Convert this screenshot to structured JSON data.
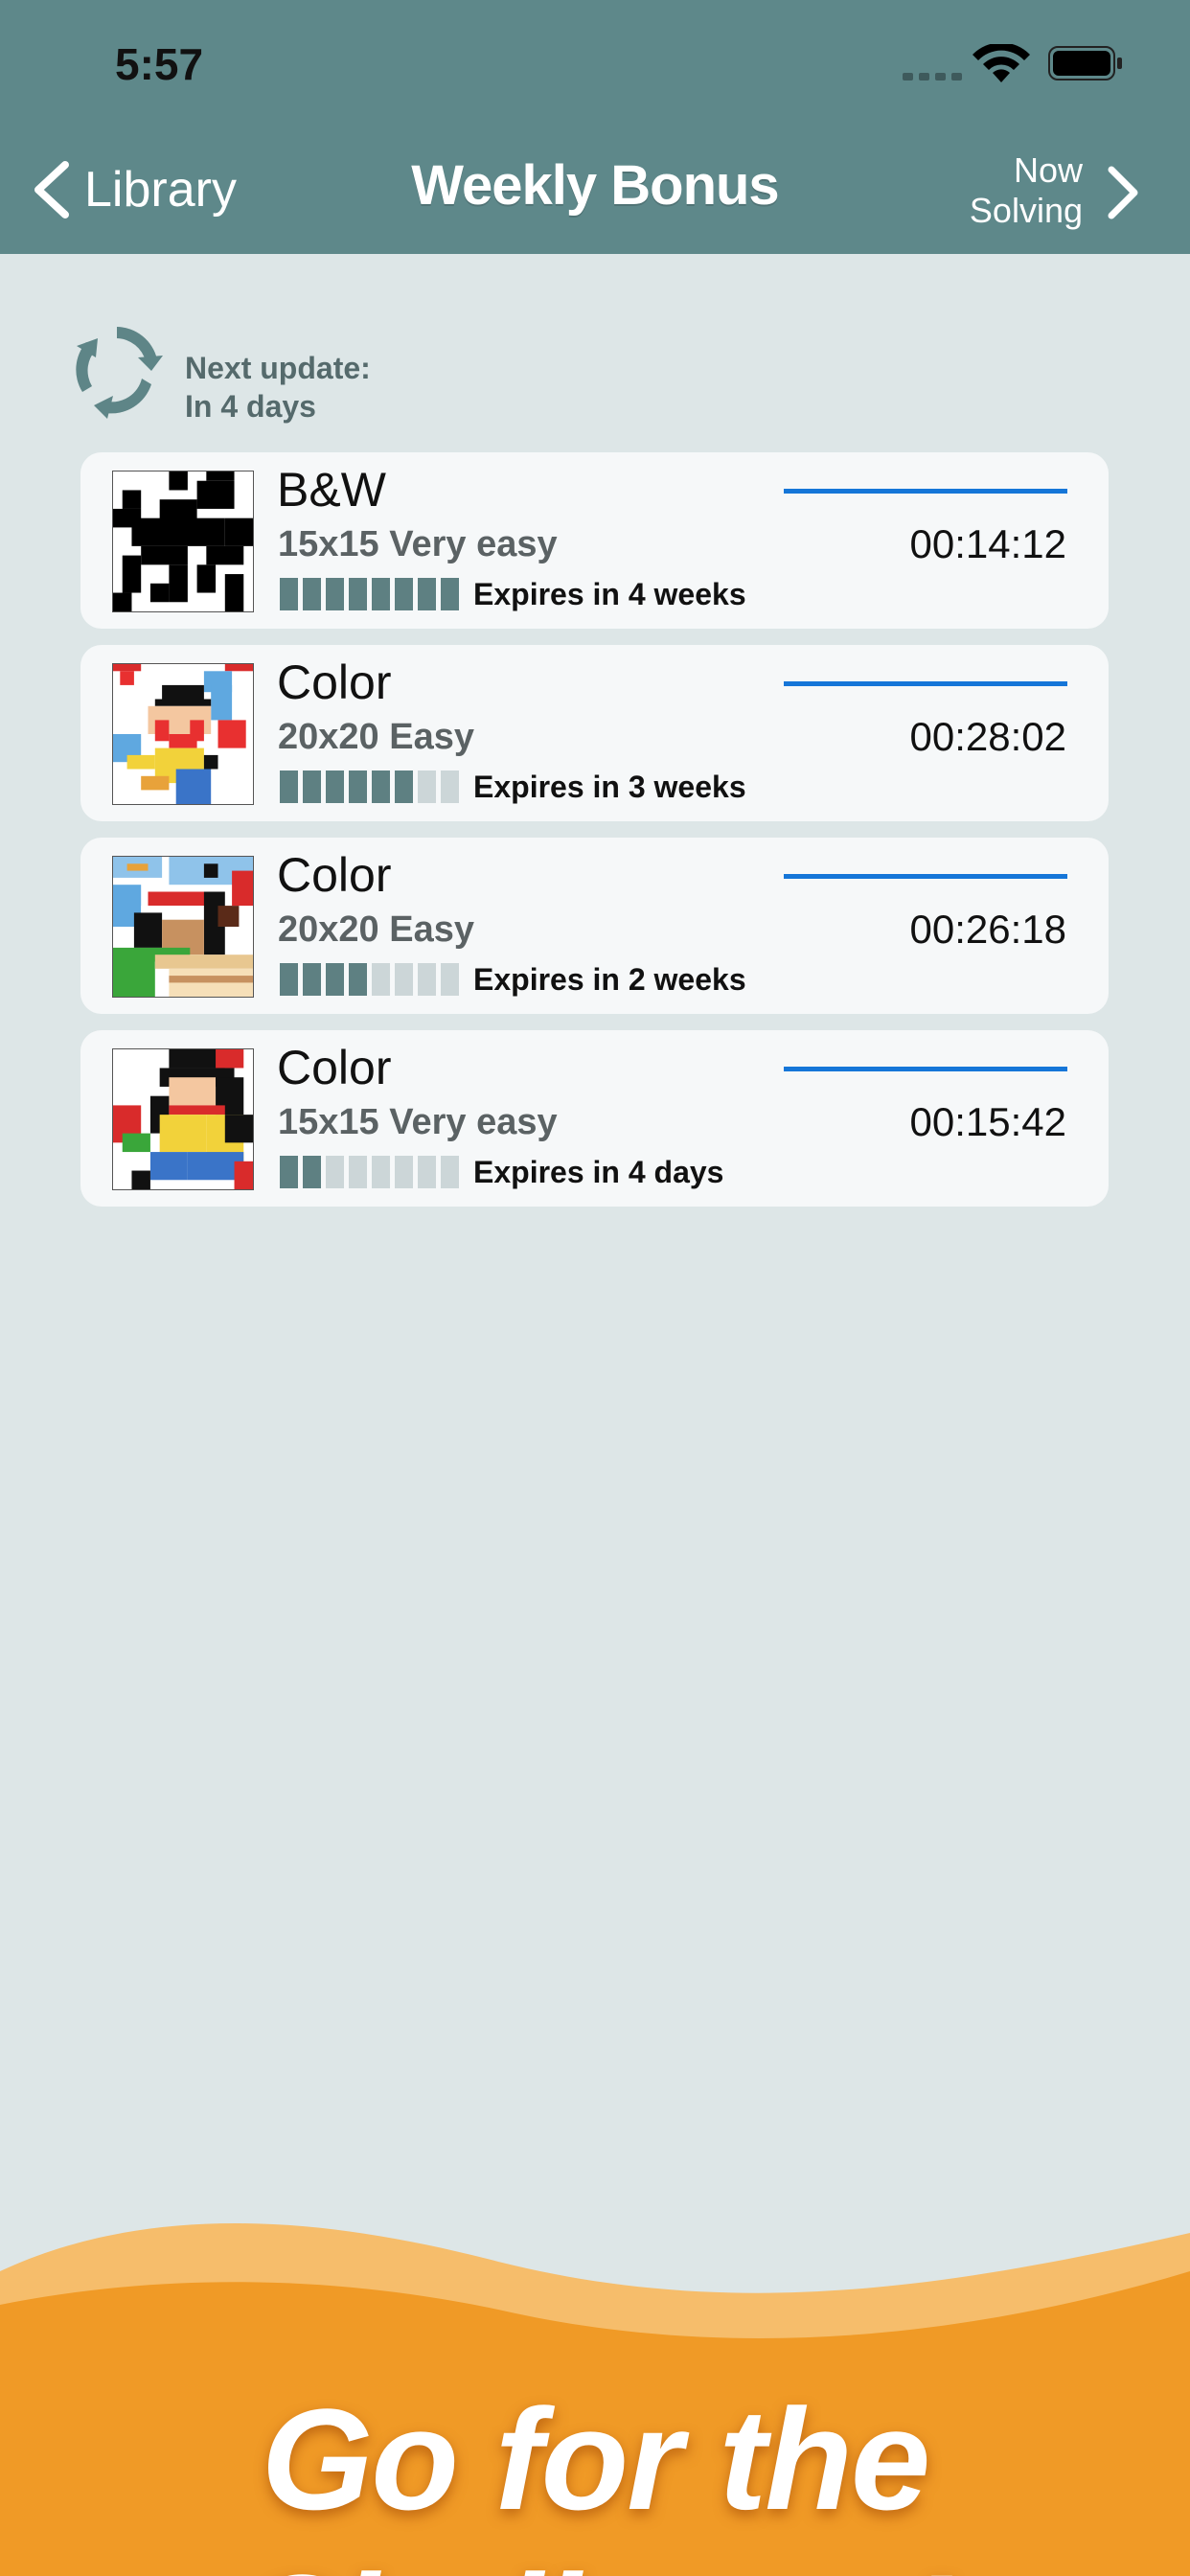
{
  "status_bar": {
    "time": "5:57"
  },
  "nav": {
    "back_label": "Library",
    "title": "Weekly Bonus",
    "forward_label_line1": "Now",
    "forward_label_line2": "Solving"
  },
  "next_update": {
    "line1": "Next update:",
    "line2": "In 4 days"
  },
  "puzzles": [
    {
      "type": "B&W",
      "size": "15x15 Very easy",
      "expires": "Expires in 4 weeks",
      "time": "00:14:12",
      "freshness_filled": 8,
      "freshness_total": 8
    },
    {
      "type": "Color",
      "size": "20x20 Easy",
      "expires": "Expires in 3 weeks",
      "time": "00:28:02",
      "freshness_filled": 6,
      "freshness_total": 8
    },
    {
      "type": "Color",
      "size": "20x20 Easy",
      "expires": "Expires in 2 weeks",
      "time": "00:26:18",
      "freshness_filled": 4,
      "freshness_total": 8
    },
    {
      "type": "Color",
      "size": "15x15 Very easy",
      "expires": "Expires in 4 days",
      "time": "00:15:42",
      "freshness_filled": 2,
      "freshness_total": 8
    }
  ],
  "banner": {
    "text": "Go for the Challenge!"
  },
  "colors": {
    "nav_bg": "#5e888a",
    "page_bg": "#dde6e7",
    "bar_filled": "#5e8082",
    "bar_empty": "#ccd6d8",
    "progress": "#1576d8",
    "banner_orange": "#f09a26"
  }
}
